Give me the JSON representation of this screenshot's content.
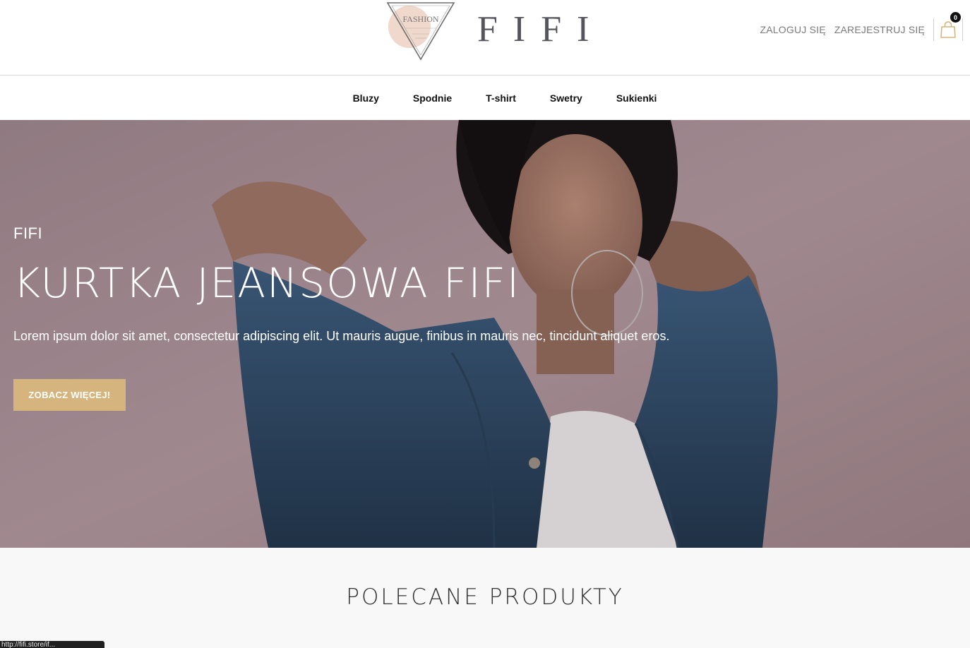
{
  "header": {
    "logo_badge_text": "FASHION",
    "logo_wordmark": "FIFI",
    "login_label": "ZALOGUJ SIĘ",
    "register_label": "ZAREJESTRUJ SIĘ",
    "cart_count": "0"
  },
  "nav": {
    "items": [
      {
        "label": "Bluzy"
      },
      {
        "label": "Spodnie"
      },
      {
        "label": "T-shirt"
      },
      {
        "label": "Swetry"
      },
      {
        "label": "Sukienki"
      }
    ]
  },
  "hero": {
    "eyebrow": "FIFI",
    "title": "KURTKA JEANSOWA FIFI",
    "text": "Lorem ipsum dolor sit amet, consectetur adipiscing elit. Ut mauris augue, finibus in mauris nec, tincidunt aliquet eros.",
    "button_label": "ZOBACZ WIĘCEJ!"
  },
  "featured": {
    "title": "POLECANE PRODUKTY"
  },
  "status_bar": {
    "url": "http://fifi.store/if..."
  },
  "colors": {
    "accent": "#d5b57d",
    "logo_blush": "#f0d9cc",
    "wordmark": "#55555d",
    "hero_overlay": "#a48d94"
  }
}
